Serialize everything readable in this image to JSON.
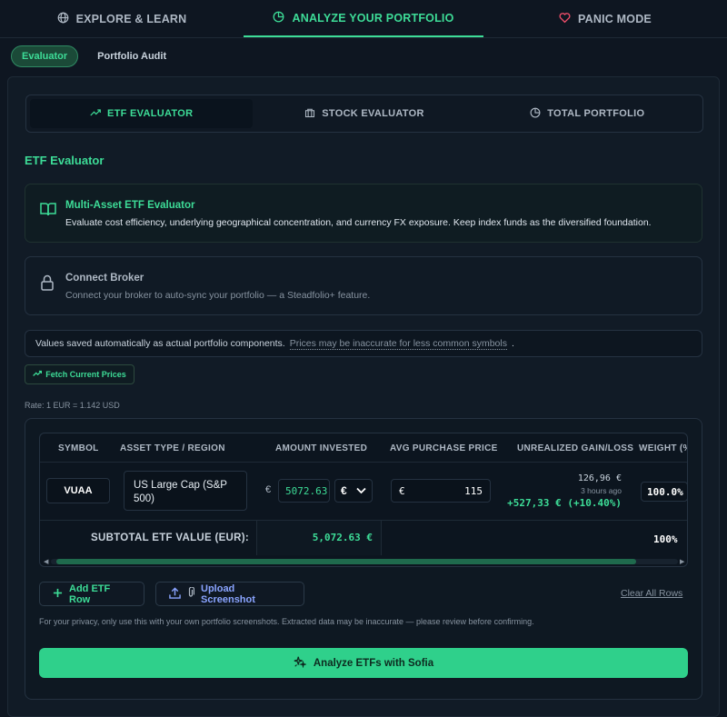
{
  "top_tabs": [
    {
      "label": "EXPLORE & LEARN",
      "icon": "globe-icon"
    },
    {
      "label": "ANALYZE YOUR PORTFOLIO",
      "icon": "pie-chart-icon"
    },
    {
      "label": "PANIC MODE",
      "icon": "heart-icon"
    }
  ],
  "sub_tabs": [
    "Evaluator",
    "Portfolio Audit"
  ],
  "segments": [
    {
      "label": "ETF EVALUATOR",
      "icon": "trend-up-icon"
    },
    {
      "label": "STOCK EVALUATOR",
      "icon": "bank-icon"
    },
    {
      "label": "TOTAL PORTFOLIO",
      "icon": "pie-chart-icon"
    }
  ],
  "section_title": "ETF Evaluator",
  "info_card": {
    "title": "Multi-Asset ETF Evaluator",
    "description": "Evaluate cost efficiency, underlying geographical concentration, and currency FX exposure. Keep index funds as the diversified foundation."
  },
  "broker_card": {
    "title": "Connect Broker",
    "description": "Connect your broker to auto-sync your portfolio — a Steadfolio+ feature."
  },
  "note_bar": {
    "text": "Values saved automatically as actual portfolio components.",
    "link": "Prices may be inaccurate for less common symbols",
    "suffix": "."
  },
  "fetch_button": "Fetch Current Prices",
  "rate": "Rate: 1 EUR = 1.142 USD",
  "table": {
    "headers": [
      "SYMBOL",
      "ASSET TYPE / REGION",
      "AMOUNT INVESTED",
      "AVG PURCHASE PRICE",
      "UNREALIZED GAIN/LOSS",
      "WEIGHT (%"
    ],
    "row": {
      "symbol": "VUAA",
      "asset_type": "US Large Cap (S&P 500)",
      "euro_sign": "€",
      "amount": "5072.63",
      "currency": "€",
      "avg_euro_sign": "€",
      "avg_price": "115",
      "gain_current": "126,96 €",
      "gain_time": "3 hours ago",
      "gain_value": "+527,33 € (+10.40%)",
      "weight": "100.0%"
    },
    "subtotal_label": "SUBTOTAL ETF VALUE (EUR):",
    "subtotal_value": "5,072.63 €",
    "subtotal_pct": "100%"
  },
  "buttons": {
    "add_row": "Add ETF Row",
    "upload": "Upload Screenshot",
    "clear": "Clear All Rows",
    "analyze": "Analyze ETFs with Sofia"
  },
  "privacy_note": "For your privacy, only use this with your own portfolio screenshots. Extracted data may be inaccurate — please review before confirming.",
  "colors": {
    "accent": "#3ddc97",
    "background": "#0e1621",
    "link_blue": "#8aa4ff",
    "panic_red": "#f04e6a"
  }
}
